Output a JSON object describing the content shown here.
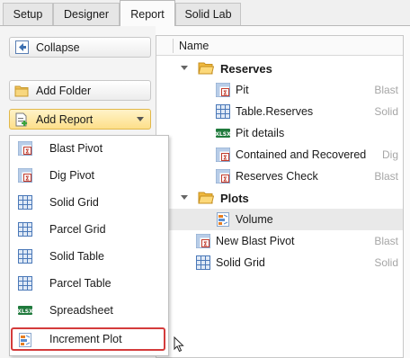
{
  "tabs": [
    {
      "label": "Setup"
    },
    {
      "label": "Designer"
    },
    {
      "label": "Report"
    },
    {
      "label": "Solid Lab"
    }
  ],
  "active_tab": "Report",
  "left_panel": {
    "collapse_label": "Collapse",
    "add_folder_label": "Add Folder",
    "add_report_label": "Add Report"
  },
  "add_report_menu": {
    "items": [
      {
        "label": "Blast Pivot",
        "icon": "pivot-icon"
      },
      {
        "label": "Dig Pivot",
        "icon": "pivot-icon"
      },
      {
        "label": "Solid Grid",
        "icon": "grid-icon"
      },
      {
        "label": "Parcel Grid",
        "icon": "grid-icon"
      },
      {
        "label": "Solid Table",
        "icon": "grid-icon"
      },
      {
        "label": "Parcel Table",
        "icon": "grid-icon"
      },
      {
        "label": "Spreadsheet",
        "icon": "xlsx-icon"
      },
      {
        "label": "Increment Plot",
        "icon": "plot-icon",
        "highlighted": true
      }
    ]
  },
  "tree": {
    "header": "Name",
    "rows": [
      {
        "label": "Reserves",
        "type": "",
        "kind": "folder",
        "expanded": true
      },
      {
        "label": "Pit",
        "type": "Blast",
        "kind": "pivot"
      },
      {
        "label": "Table.Reserves",
        "type": "Solid",
        "kind": "grid"
      },
      {
        "label": "Pit details",
        "type": "",
        "kind": "xlsx"
      },
      {
        "label": "Contained and Recovered",
        "type": "Dig",
        "kind": "pivot"
      },
      {
        "label": "Reserves Check",
        "type": "Blast",
        "kind": "pivot"
      },
      {
        "label": "Plots",
        "type": "",
        "kind": "folder",
        "expanded": true
      },
      {
        "label": "Volume",
        "type": "",
        "kind": "plot",
        "selected": true
      },
      {
        "label": "New Blast Pivot",
        "type": "Blast",
        "kind": "pivot"
      },
      {
        "label": "Solid Grid",
        "type": "Solid",
        "kind": "grid"
      }
    ]
  }
}
